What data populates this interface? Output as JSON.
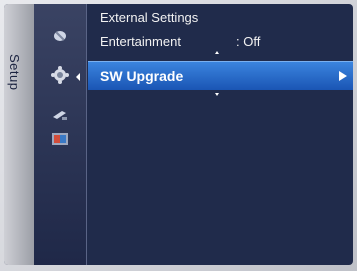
{
  "category": {
    "label": "Setup"
  },
  "icons": [
    {
      "name": "picture-icon"
    },
    {
      "name": "setup-gear-icon"
    },
    {
      "name": "input-icon"
    },
    {
      "name": "application-icon"
    }
  ],
  "menu": {
    "items": [
      {
        "label": "External Settings",
        "value": ""
      },
      {
        "label": "Entertainment",
        "value": ": Off"
      },
      {
        "label": "SW Upgrade",
        "value": ""
      }
    ],
    "selected_index": 2
  },
  "colors": {
    "screen_bg": "#202b4b",
    "highlight": "#2a6fd0",
    "text": "#f2f2f2"
  }
}
